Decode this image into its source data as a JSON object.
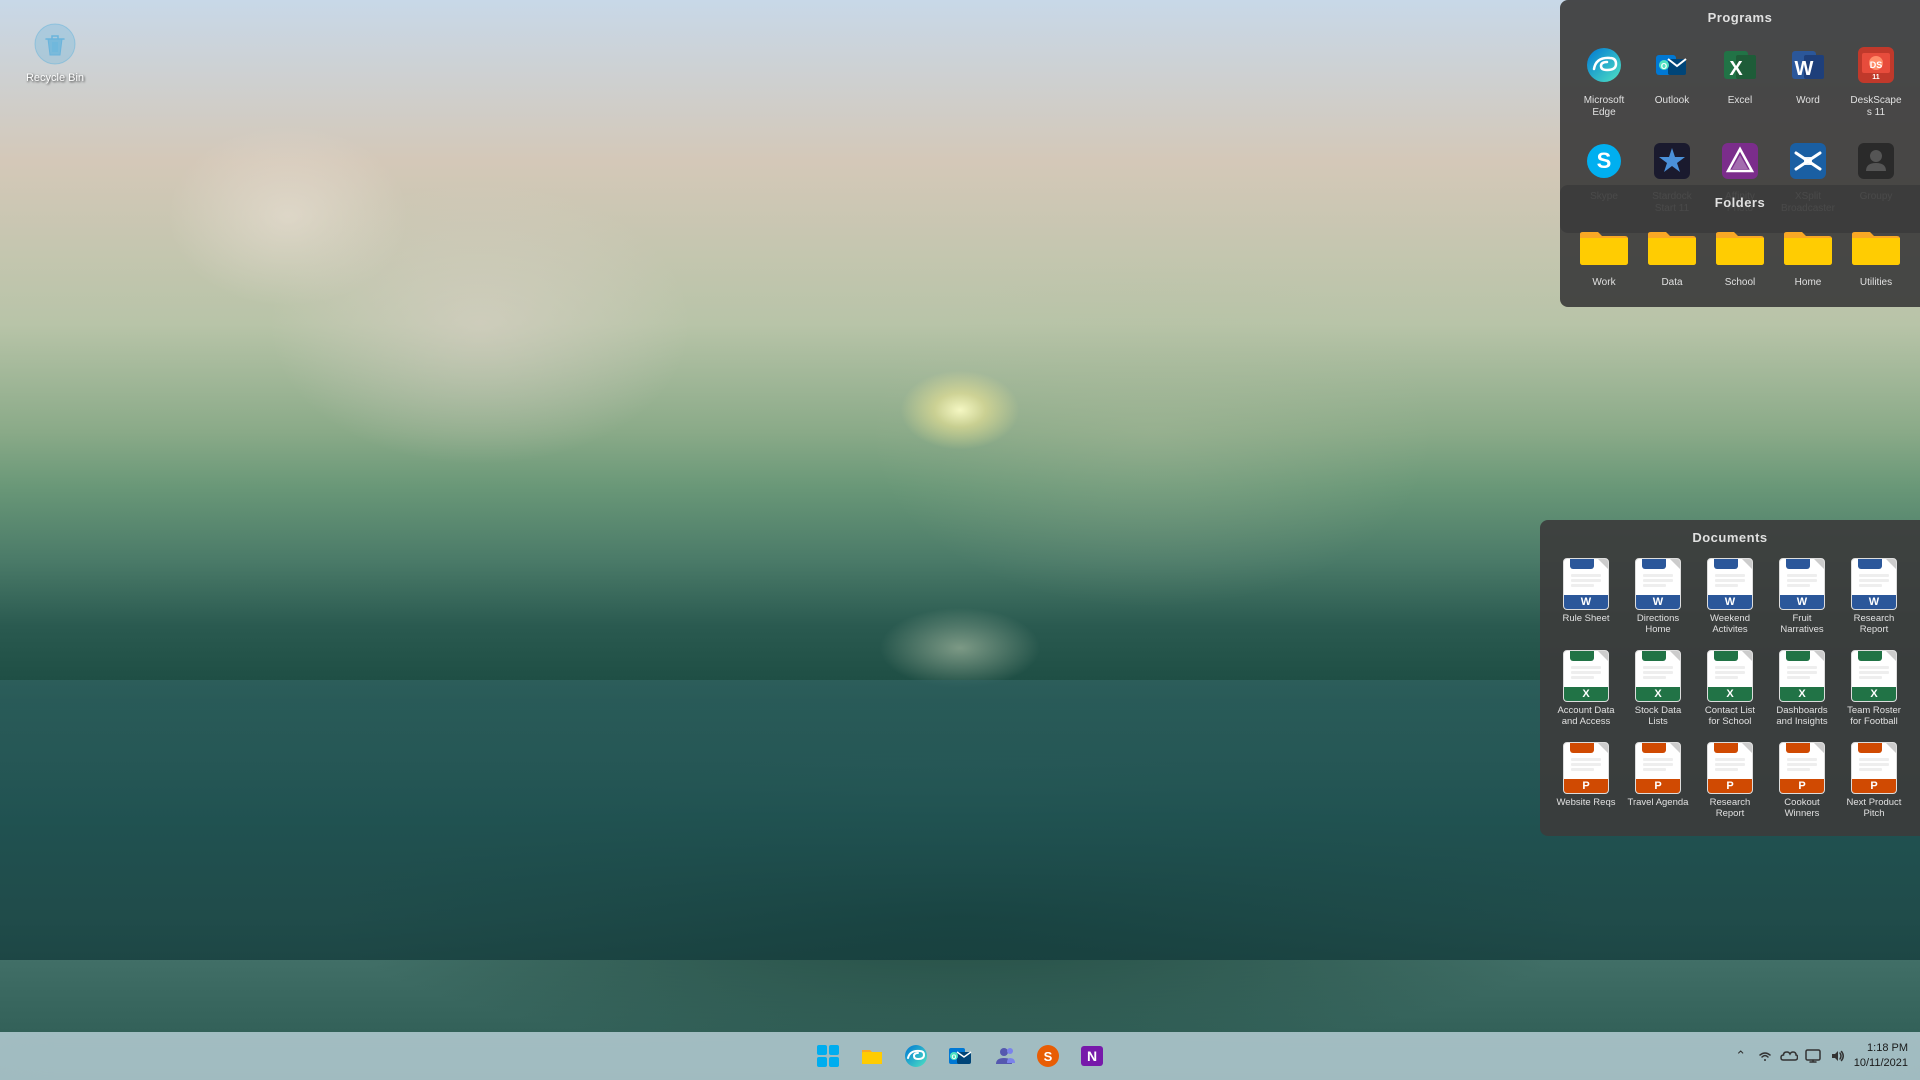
{
  "desktop": {
    "recyclebin": {
      "label": "Recycle Bin"
    }
  },
  "programs_panel": {
    "title": "Programs",
    "apps": [
      {
        "id": "microsoft-edge",
        "label": "Microsoft Edge",
        "bg": "edge-bg",
        "icon": "🌐",
        "letter": "e"
      },
      {
        "id": "outlook",
        "label": "Outlook",
        "bg": "outlook-bg",
        "icon": "📧",
        "letter": "O"
      },
      {
        "id": "excel",
        "label": "Excel",
        "bg": "excel-bg",
        "icon": "X",
        "letter": "X"
      },
      {
        "id": "word",
        "label": "Word",
        "bg": "word-bg",
        "icon": "W",
        "letter": "W"
      },
      {
        "id": "deskscapes",
        "label": "DeskScapes 11",
        "bg": "deskscapes-bg",
        "icon": "DS",
        "letter": "DS"
      },
      {
        "id": "skype",
        "label": "Skype",
        "bg": "skype-bg",
        "icon": "S",
        "letter": "S"
      },
      {
        "id": "stardock",
        "label": "Stardock Start 11",
        "bg": "stardock-bg",
        "icon": "S",
        "letter": "S"
      },
      {
        "id": "affinity-photo",
        "label": "Affinity Photo",
        "bg": "affinity-bg",
        "icon": "A",
        "letter": "A"
      },
      {
        "id": "xsplit",
        "label": "XSplit Broadcaster",
        "bg": "xsplit-bg",
        "icon": "X",
        "letter": "X"
      },
      {
        "id": "groupy",
        "label": "Groupy",
        "bg": "groupy-bg",
        "icon": "G",
        "letter": "G"
      }
    ]
  },
  "folders_panel": {
    "title": "Folders",
    "folders": [
      {
        "id": "work",
        "label": "Work"
      },
      {
        "id": "data",
        "label": "Data"
      },
      {
        "id": "school",
        "label": "School"
      },
      {
        "id": "home",
        "label": "Home"
      },
      {
        "id": "utilities",
        "label": "Utilities"
      }
    ]
  },
  "documents_panel": {
    "title": "Documents",
    "docs": [
      {
        "id": "rule-sheet",
        "label": "Rule Sheet",
        "type": "word",
        "letter": "W"
      },
      {
        "id": "directions-home",
        "label": "Directions Home",
        "type": "word",
        "letter": "W"
      },
      {
        "id": "weekend-activities",
        "label": "Weekend Activites",
        "type": "word",
        "letter": "W"
      },
      {
        "id": "fruit-narratives",
        "label": "Fruit Narratives",
        "type": "word",
        "letter": "W"
      },
      {
        "id": "research-report",
        "label": "Research Report",
        "type": "word",
        "letter": "W"
      },
      {
        "id": "account-data",
        "label": "Account Data and Access",
        "type": "excel",
        "letter": "X"
      },
      {
        "id": "stock-data",
        "label": "Stock Data Lists",
        "type": "excel",
        "letter": "X"
      },
      {
        "id": "contact-list",
        "label": "Contact List for School",
        "type": "excel",
        "letter": "X"
      },
      {
        "id": "dashboards",
        "label": "Dashboards and Insights",
        "type": "excel",
        "letter": "X"
      },
      {
        "id": "team-roster",
        "label": "Team Roster for Football",
        "type": "excel",
        "letter": "X"
      },
      {
        "id": "website-reqs",
        "label": "Website Reqs",
        "type": "ppt",
        "letter": "P"
      },
      {
        "id": "travel-agenda",
        "label": "Travel Agenda",
        "type": "ppt",
        "letter": "P"
      },
      {
        "id": "research-report-ppt",
        "label": "Research Report",
        "type": "ppt",
        "letter": "P"
      },
      {
        "id": "cookout-winners",
        "label": "Cookout Winners",
        "type": "ppt",
        "letter": "P"
      },
      {
        "id": "next-product-pitch",
        "label": "Next Product Pitch",
        "type": "ppt",
        "letter": "P"
      }
    ]
  },
  "taskbar": {
    "start_label": "Start",
    "time": "1:18 PM",
    "date": "10/11/2021",
    "apps": [
      {
        "id": "start",
        "label": "Start"
      },
      {
        "id": "file-explorer",
        "label": "File Explorer"
      },
      {
        "id": "edge",
        "label": "Microsoft Edge"
      },
      {
        "id": "outlook-tb",
        "label": "Outlook"
      },
      {
        "id": "teams",
        "label": "Microsoft Teams"
      },
      {
        "id": "stardock-tb",
        "label": "Stardock"
      },
      {
        "id": "onenote",
        "label": "OneNote"
      }
    ],
    "tray_icons": [
      "chevron-up",
      "wifi",
      "cloud",
      "display",
      "volume",
      "battery"
    ]
  }
}
